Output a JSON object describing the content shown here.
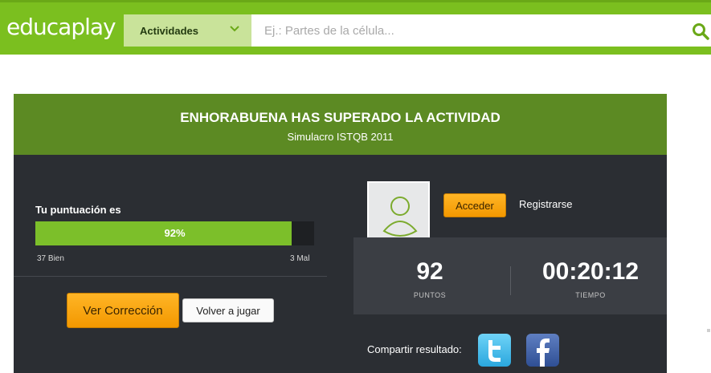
{
  "header": {
    "logo_light": "educa",
    "logo_bold": "play",
    "category_label": "Actividades",
    "search_placeholder": "Ej.: Partes de la célula...",
    "accent_color": "#7bbf1f"
  },
  "result": {
    "title": "ENHORABUENA HAS SUPERADO LA ACTIVIDAD",
    "activity_name": "Simulacro ISTQB 2011",
    "score_label": "Tu puntuación es",
    "score_percent": 92,
    "score_text": "92%",
    "correct_label": "37 Bien",
    "wrong_label": "3 Mal",
    "correction_button": "Ver Corrección",
    "replay_button": "Volver a jugar"
  },
  "account": {
    "login_button": "Acceder",
    "register_link": "Registrarse"
  },
  "stats": {
    "points_value": "92",
    "points_label": "PUNTOS",
    "time_value": "00:20:12",
    "time_label": "TIEMPO"
  },
  "share": {
    "label": "Compartir resultado:",
    "icons": [
      "twitter-icon",
      "facebook-icon"
    ]
  }
}
